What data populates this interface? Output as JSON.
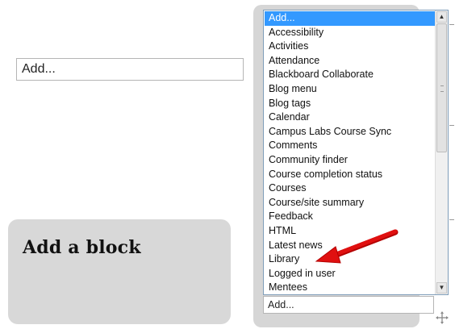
{
  "add_block": {
    "title": "Add a block",
    "select_value": "Add..."
  },
  "listbox": {
    "options": [
      "Add...",
      "Accessibility",
      "Activities",
      "Attendance",
      "Blackboard Collaborate",
      "Blog menu",
      "Blog tags",
      "Calendar",
      "Campus Labs Course Sync",
      "Comments",
      "Community finder",
      "Course completion status",
      "Courses",
      "Course/site summary",
      "Feedback",
      "HTML",
      "Latest news",
      "Library",
      "Logged in user",
      "Mentees"
    ],
    "selected_index": 0
  },
  "bottom_select": {
    "value": "Add..."
  },
  "colors": {
    "selection": "#3399ff",
    "panel": "#d6d6d6",
    "arrow": "#e01010"
  },
  "icons": [
    "move-icon",
    "scroll-up-icon",
    "scroll-down-icon",
    "red-arrow-icon"
  ]
}
